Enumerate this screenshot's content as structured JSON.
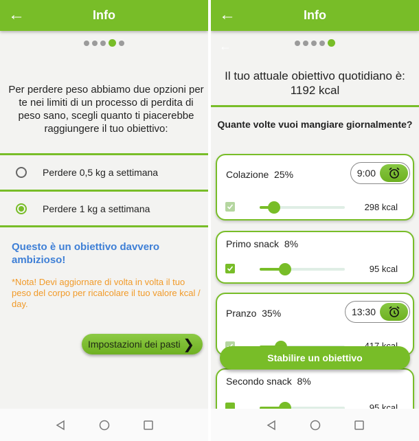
{
  "left_screen": {
    "appbar": {
      "title": "Info",
      "back_icon": "arrow-left-icon"
    },
    "pager": {
      "total": 5,
      "active_index": 3
    },
    "intro_text": "Per perdere peso abbiamo due opzioni per te nei limiti di un processo di perdita di peso sano, scegli quanto ti piacerebbe raggiungere il tuo obiettivo:",
    "options": [
      {
        "label": "Perdere 0,5 kg a settimana",
        "selected": false
      },
      {
        "label": "Perdere 1 kg a settimana",
        "selected": true
      }
    ],
    "ambitious_text": "Questo è un obiettivo davvero ambizioso!",
    "note_text": "*Nota! Devi aggiornare di volta in volta il tuo peso del corpo per ricalcolare il tuo valore kcal / day.",
    "meal_settings_button": "Impostazioni dei pasti"
  },
  "right_screen": {
    "appbar": {
      "title": "Info",
      "back_icon": "arrow-left-icon"
    },
    "pager": {
      "total": 5,
      "active_index": 4
    },
    "goal_line1": "Il tuo attuale obiettivo quotidiano è:",
    "goal_line2": "1192 kcal",
    "question": "Quante volte vuoi mangiare giornalmente?",
    "meals": [
      {
        "name": "Colazione",
        "percent": "25%",
        "time": "9:00",
        "kcal": "298 kcal",
        "checked": true,
        "check_disabled": true,
        "slider_fraction": 0.17
      },
      {
        "name": "Primo snack",
        "percent": "8%",
        "time": null,
        "kcal": "95 kcal",
        "checked": true,
        "check_disabled": false,
        "slider_fraction": 0.3
      },
      {
        "name": "Pranzo",
        "percent": "35%",
        "time": "13:30",
        "kcal": "417 kcal",
        "checked": true,
        "check_disabled": true,
        "slider_fraction": 0.25
      },
      {
        "name": "Secondo snack",
        "percent": "8%",
        "time": null,
        "kcal": "95 kcal",
        "checked": true,
        "check_disabled": false,
        "slider_fraction": 0.3
      }
    ],
    "cta_button": "Stabilire un obiettivo"
  },
  "colors": {
    "accent": "#78bd28",
    "link_blue": "#3e7fd6",
    "note_orange": "#f19a28"
  },
  "navbar": {
    "icons": [
      "back-triangle-icon",
      "home-circle-icon",
      "recents-square-icon"
    ]
  }
}
